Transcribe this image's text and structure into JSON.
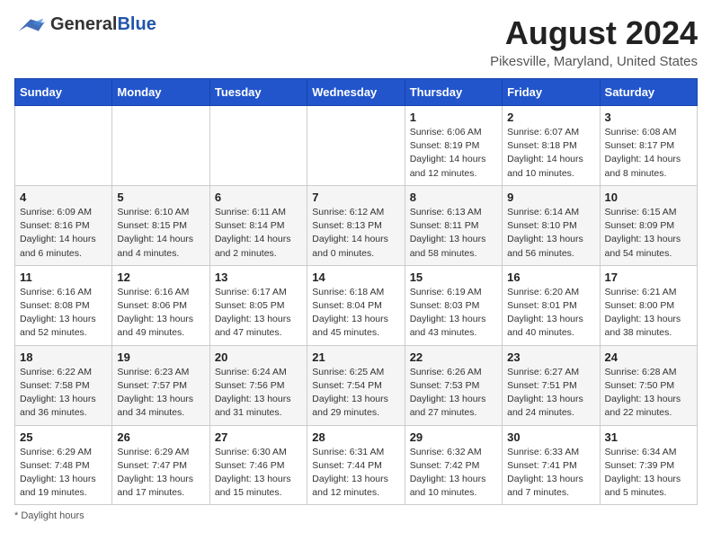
{
  "header": {
    "logo_general": "General",
    "logo_blue": "Blue",
    "month_year": "August 2024",
    "location": "Pikesville, Maryland, United States"
  },
  "days_of_week": [
    "Sunday",
    "Monday",
    "Tuesday",
    "Wednesday",
    "Thursday",
    "Friday",
    "Saturday"
  ],
  "weeks": [
    [
      {
        "day": "",
        "info": ""
      },
      {
        "day": "",
        "info": ""
      },
      {
        "day": "",
        "info": ""
      },
      {
        "day": "",
        "info": ""
      },
      {
        "day": "1",
        "info": "Sunrise: 6:06 AM\nSunset: 8:19 PM\nDaylight: 14 hours and 12 minutes."
      },
      {
        "day": "2",
        "info": "Sunrise: 6:07 AM\nSunset: 8:18 PM\nDaylight: 14 hours and 10 minutes."
      },
      {
        "day": "3",
        "info": "Sunrise: 6:08 AM\nSunset: 8:17 PM\nDaylight: 14 hours and 8 minutes."
      }
    ],
    [
      {
        "day": "4",
        "info": "Sunrise: 6:09 AM\nSunset: 8:16 PM\nDaylight: 14 hours and 6 minutes."
      },
      {
        "day": "5",
        "info": "Sunrise: 6:10 AM\nSunset: 8:15 PM\nDaylight: 14 hours and 4 minutes."
      },
      {
        "day": "6",
        "info": "Sunrise: 6:11 AM\nSunset: 8:14 PM\nDaylight: 14 hours and 2 minutes."
      },
      {
        "day": "7",
        "info": "Sunrise: 6:12 AM\nSunset: 8:13 PM\nDaylight: 14 hours and 0 minutes."
      },
      {
        "day": "8",
        "info": "Sunrise: 6:13 AM\nSunset: 8:11 PM\nDaylight: 13 hours and 58 minutes."
      },
      {
        "day": "9",
        "info": "Sunrise: 6:14 AM\nSunset: 8:10 PM\nDaylight: 13 hours and 56 minutes."
      },
      {
        "day": "10",
        "info": "Sunrise: 6:15 AM\nSunset: 8:09 PM\nDaylight: 13 hours and 54 minutes."
      }
    ],
    [
      {
        "day": "11",
        "info": "Sunrise: 6:16 AM\nSunset: 8:08 PM\nDaylight: 13 hours and 52 minutes."
      },
      {
        "day": "12",
        "info": "Sunrise: 6:16 AM\nSunset: 8:06 PM\nDaylight: 13 hours and 49 minutes."
      },
      {
        "day": "13",
        "info": "Sunrise: 6:17 AM\nSunset: 8:05 PM\nDaylight: 13 hours and 47 minutes."
      },
      {
        "day": "14",
        "info": "Sunrise: 6:18 AM\nSunset: 8:04 PM\nDaylight: 13 hours and 45 minutes."
      },
      {
        "day": "15",
        "info": "Sunrise: 6:19 AM\nSunset: 8:03 PM\nDaylight: 13 hours and 43 minutes."
      },
      {
        "day": "16",
        "info": "Sunrise: 6:20 AM\nSunset: 8:01 PM\nDaylight: 13 hours and 40 minutes."
      },
      {
        "day": "17",
        "info": "Sunrise: 6:21 AM\nSunset: 8:00 PM\nDaylight: 13 hours and 38 minutes."
      }
    ],
    [
      {
        "day": "18",
        "info": "Sunrise: 6:22 AM\nSunset: 7:58 PM\nDaylight: 13 hours and 36 minutes."
      },
      {
        "day": "19",
        "info": "Sunrise: 6:23 AM\nSunset: 7:57 PM\nDaylight: 13 hours and 34 minutes."
      },
      {
        "day": "20",
        "info": "Sunrise: 6:24 AM\nSunset: 7:56 PM\nDaylight: 13 hours and 31 minutes."
      },
      {
        "day": "21",
        "info": "Sunrise: 6:25 AM\nSunset: 7:54 PM\nDaylight: 13 hours and 29 minutes."
      },
      {
        "day": "22",
        "info": "Sunrise: 6:26 AM\nSunset: 7:53 PM\nDaylight: 13 hours and 27 minutes."
      },
      {
        "day": "23",
        "info": "Sunrise: 6:27 AM\nSunset: 7:51 PM\nDaylight: 13 hours and 24 minutes."
      },
      {
        "day": "24",
        "info": "Sunrise: 6:28 AM\nSunset: 7:50 PM\nDaylight: 13 hours and 22 minutes."
      }
    ],
    [
      {
        "day": "25",
        "info": "Sunrise: 6:29 AM\nSunset: 7:48 PM\nDaylight: 13 hours and 19 minutes."
      },
      {
        "day": "26",
        "info": "Sunrise: 6:29 AM\nSunset: 7:47 PM\nDaylight: 13 hours and 17 minutes."
      },
      {
        "day": "27",
        "info": "Sunrise: 6:30 AM\nSunset: 7:46 PM\nDaylight: 13 hours and 15 minutes."
      },
      {
        "day": "28",
        "info": "Sunrise: 6:31 AM\nSunset: 7:44 PM\nDaylight: 13 hours and 12 minutes."
      },
      {
        "day": "29",
        "info": "Sunrise: 6:32 AM\nSunset: 7:42 PM\nDaylight: 13 hours and 10 minutes."
      },
      {
        "day": "30",
        "info": "Sunrise: 6:33 AM\nSunset: 7:41 PM\nDaylight: 13 hours and 7 minutes."
      },
      {
        "day": "31",
        "info": "Sunrise: 6:34 AM\nSunset: 7:39 PM\nDaylight: 13 hours and 5 minutes."
      }
    ]
  ],
  "footer": "Daylight hours"
}
